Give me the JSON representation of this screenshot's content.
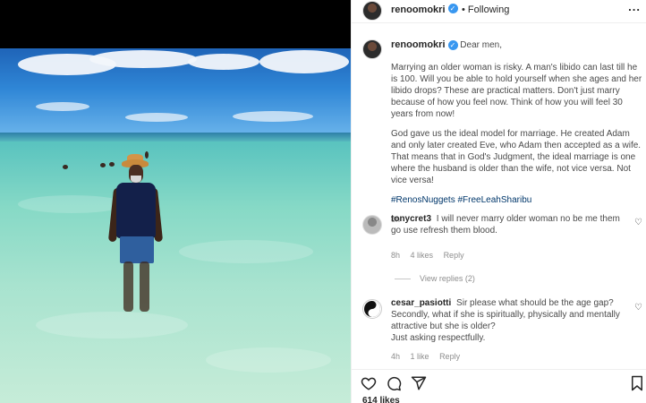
{
  "post": {
    "username": "renoomokri",
    "follow_status": "Following",
    "more_label": "...",
    "caption": {
      "greeting": "Dear men,",
      "para1": "Marrying an older woman is risky. A man's libido can last till he is 100. Will you be able to hold yourself when she ages and her libido drops? These are practical matters. Don't just marry because of how you feel now. Think of how you will feel 30 years from now!",
      "para2": "God gave us the ideal model for marriage. He created Adam and only later created Eve, who Adam then accepted as a wife. That means that in God's Judgment, the ideal marriage is one where the husband is older than the wife, not vice versa. Not vice versa!",
      "hashtags": "#RenosNuggets #FreeLeahSharibu",
      "time": "8h"
    },
    "likes_text": "614 likes"
  },
  "comments": [
    {
      "username": "tonycret3",
      "text": "I will never marry older woman no be me them go use refresh them blood.",
      "time": "8h",
      "likes": "4 likes",
      "reply": "Reply"
    },
    {
      "username": "cesar_pasiotti",
      "text": "Sir please what should be the age gap? Secondly, what if she is spiritually, physically and mentally attractive but she is older?",
      "text2": "Just asking respectfully.",
      "time": "4h",
      "likes": "1 like",
      "reply": "Reply"
    }
  ],
  "view_replies": "View replies (2)",
  "icons": {
    "like": "heart-icon",
    "comment": "comment-icon",
    "share": "share-icon",
    "save": "bookmark-icon",
    "verified": "verified-badge-icon"
  },
  "colors": {
    "verified": "#3897f0",
    "hashtag": "#00376b",
    "meta": "#8e8e8e"
  }
}
